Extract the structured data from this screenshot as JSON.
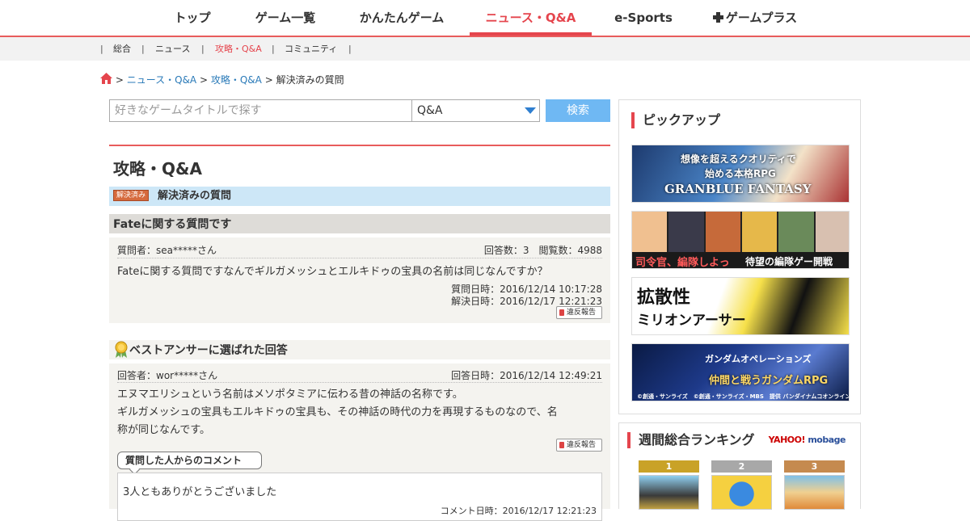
{
  "topnav": {
    "items": [
      {
        "label": "トップ"
      },
      {
        "label": "ゲーム一覧"
      },
      {
        "label": "かんたんゲーム"
      },
      {
        "label": "ニュース・Q&A",
        "active": true
      },
      {
        "label": "e-Sports"
      },
      {
        "label": "ゲームプラス",
        "icon": "plus-icon"
      }
    ]
  },
  "subnav": {
    "items": [
      {
        "label": "総合"
      },
      {
        "label": "ニュース"
      },
      {
        "label": "攻略・Q&A",
        "active": true
      },
      {
        "label": "コミュニティ"
      }
    ],
    "separator": "|"
  },
  "breadcrumb": {
    "home_icon": "home-icon",
    "separator": ">",
    "items": [
      "ニュース・Q&A",
      "攻略・Q&A",
      "解決済みの質問"
    ]
  },
  "search": {
    "placeholder": "好きなゲームタイトルで探す",
    "category": "Q&A",
    "button_label": "検索"
  },
  "main": {
    "title": "攻略・Q&A",
    "solved_badge": "解決済み",
    "solved_label": "解決済みの質問",
    "question": {
      "title": "Fateに関する質問です",
      "asker": "質問者：sea*****さん",
      "stats": "回答数：3　閲覧数：4988",
      "body": "Fateに関する質問ですなんでギルガメッシュとエルキドゥの宝具の名前は同じなんですか？",
      "asked_at": "質問日時：2016/12/14 10:17:28",
      "solved_at": "解決日時：2016/12/17 12:21:23",
      "report_label": "違反報告"
    },
    "best_answer": {
      "heading": "ベストアンサーに選ばれた回答",
      "medal_icon": "medal-icon",
      "answerer": "回答者：wor*****さん",
      "answered_at": "回答日時：2016/12/14 12:49:21",
      "body_lines": [
        "エヌマエリシュという名前はメソポタミアに伝わる昔の神話の名称です。",
        "ギルガメッシュの宝具もエルキドゥの宝具も、その神話の時代の力を再現するものなので、名",
        "称が同じなんです。"
      ],
      "report_label": "違反報告",
      "comment_heading": "質問した人からのコメント",
      "comment_text": "3人ともありがとうございました",
      "comment_date": "コメント日時：2016/12/17 12:21:23"
    }
  },
  "sidebar": {
    "pickup_heading": "ピックアップ",
    "banners": [
      {
        "name": "granblue-fantasy",
        "lines": [
          "想像を超えるクオリティで",
          "始める本格RPG",
          "GRANBLUE FANTASY"
        ]
      },
      {
        "name": "kancolle",
        "lines": [
          "司令官、編隊しよっ",
          "待望の編隊ゲー開戦"
        ]
      },
      {
        "name": "million-arthur",
        "lines": [
          "拡散性",
          "ミリオンアーサー"
        ]
      },
      {
        "name": "gundam-operations",
        "lines": [
          "ガンダムオペレーションズ",
          "仲間と戦うガンダムRPG",
          "©創通・サンライズ　©創通・サンライズ・MBS　提供 バンダイナムコオンライン"
        ]
      }
    ],
    "ranking_heading": "週間総合ランキング",
    "ranking_logo": {
      "yahoo": "YAHOO!",
      "sub": "mobage"
    },
    "ranks": [
      {
        "rank": "1",
        "color": "#c9a227"
      },
      {
        "rank": "2",
        "color": "#a8a8a8"
      },
      {
        "rank": "3",
        "color": "#c58a4f"
      }
    ]
  }
}
